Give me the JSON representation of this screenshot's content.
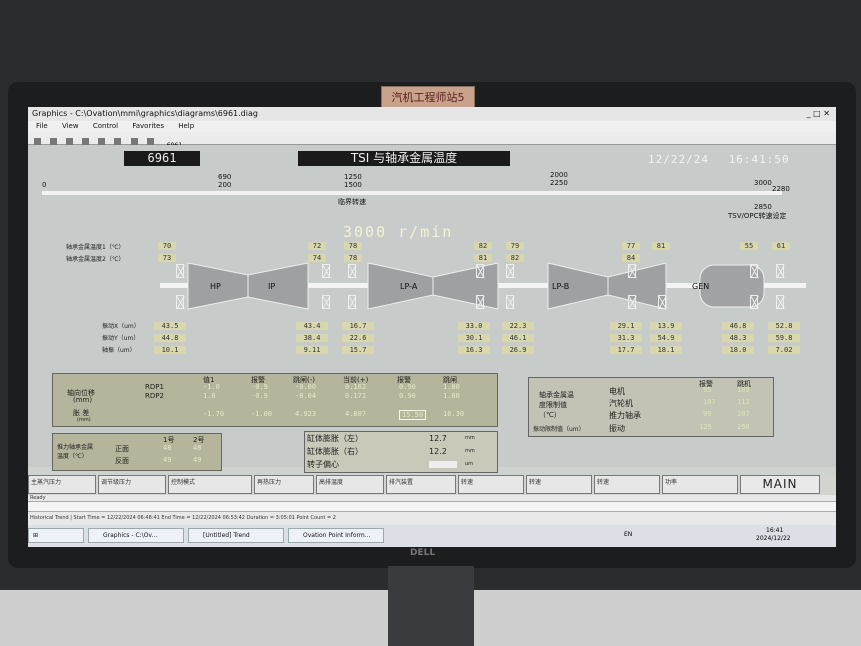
{
  "window": {
    "title": "Graphics - C:\\Ovation\\mmi\\graphics\\diagrams\\6961.diag",
    "menu": [
      "File",
      "View",
      "Control",
      "Favorites",
      "Help"
    ],
    "toolbar_field": "6961"
  },
  "sticker": "汽机工程师站5",
  "header": {
    "diagram_id": "6961",
    "title": "TSI 与轴承金属温度",
    "date": "12/22/24",
    "time": "16:41:50"
  },
  "speed_scale": {
    "marks_top": [
      "690",
      "1250",
      "2000",
      "3000"
    ],
    "marks_bottom": [
      "200",
      "1500",
      "2250",
      "2280"
    ],
    "left_zero": "0",
    "center_label": "临界转速",
    "right_value": "2850",
    "right_label": "转速",
    "right_label2": "TSV/OPC转速设定"
  },
  "speed": "3000 r/min",
  "row_labels": {
    "metal_temp": "轴承金属温度1（℃）",
    "metal_temp2": "轴承金属温度2（℃）",
    "vib_x": "振动X（um）",
    "vib_y": "振动Y（um）",
    "shaft": "轴振（um）"
  },
  "temp_row1": [
    "70",
    "72",
    "78",
    "82",
    "79",
    "77",
    "81",
    "55",
    "61"
  ],
  "temp_row2": [
    "73",
    "74",
    "78",
    "81",
    "82",
    "84"
  ],
  "turbine_labels": [
    "HP",
    "IP",
    "LP-A",
    "LP-B",
    "GEN"
  ],
  "vib_row1": [
    "43.5",
    "43.4",
    "16.7",
    "33.0",
    "22.3",
    "29.1",
    "13.9",
    "46.8",
    "52.8"
  ],
  "vib_row2": [
    "44.8",
    "38.4",
    "22.6",
    "30.1",
    "46.1",
    "31.3",
    "54.9",
    "48.3",
    "59.8"
  ],
  "vib_row3": [
    "10.1",
    "9.11",
    "15.7",
    "16.3",
    "26.9",
    "17.7",
    "18.1",
    "18.0",
    "7.02"
  ],
  "left_panel": {
    "headers": [
      "值1",
      "报警",
      "跳闸(-)",
      "当前(+)",
      "报警",
      "跳闸"
    ],
    "row_title": "轴向位移",
    "unit": "(mm)",
    "rows": [
      {
        "name": "RDP1",
        "vals": [
          "-1.0",
          "-0.9",
          "-0.00",
          "0.162",
          "0.90",
          "1.00"
        ]
      },
      {
        "name": "RDP2",
        "vals": [
          "1.0",
          "-0.9",
          "-0.04",
          "0.171",
          "0.90",
          "1.00"
        ]
      }
    ],
    "diff_title": "胀 差",
    "diff_unit": "(mm)",
    "diff_vals": [
      "-1.70",
      "-1.00",
      "4.923",
      "4.807",
      "15.50",
      "16.30"
    ]
  },
  "small_panel": {
    "title": "推力轴承金属温度（℃）",
    "headers": [
      "1号",
      "2号"
    ],
    "rows": [
      {
        "name": "正面",
        "vals": [
          "48",
          "48"
        ]
      },
      {
        "name": "反面",
        "vals": [
          "49",
          "49"
        ]
      }
    ]
  },
  "center_panel": {
    "rows": [
      {
        "name": "缸体膨胀（左）",
        "val": "12.7",
        "unit": "mm"
      },
      {
        "name": "缸体膨胀（右）",
        "val": "12.2",
        "unit": "mm"
      },
      {
        "name": "转子偏心",
        "val": "",
        "unit": "um"
      }
    ]
  },
  "right_panel": {
    "headers": [
      "报警",
      "跳机"
    ],
    "title": "轴承金属温度限制值（℃）",
    "rows": [
      {
        "name": "电机",
        "vals": [
          "95",
          "105"
        ]
      },
      {
        "name": "汽轮机",
        "vals": [
          "107",
          "113"
        ]
      },
      {
        "name": "推力轴承",
        "vals": [
          "99",
          "107"
        ]
      }
    ],
    "vib_title": "振动限制值（um）",
    "vib_row": {
      "name": "振动",
      "vals": [
        "125",
        "250"
      ]
    }
  },
  "nav_buttons": [
    "主蒸汽压力",
    "调节级压力",
    "控制模式",
    "再热压力",
    "高排温度",
    "排汽装置",
    "转速",
    "转速",
    "转速",
    "功率",
    "MAIN"
  ],
  "status": {
    "ready": "Ready",
    "trend_text": "Historical Trend | Start Time = 12/22/2024 06:48:41 End Time = 12/22/2024 06:53:42 Duration = 3:05:01 Point Count = 2",
    "lang": "EN"
  },
  "taskbar": {
    "items": [
      "Graphics - C:\\Ov...",
      "[Untitled] Trend",
      "Ovation Point Inform..."
    ],
    "clock": "16:41",
    "date": "2024/12/22"
  },
  "brand": "DELL"
}
